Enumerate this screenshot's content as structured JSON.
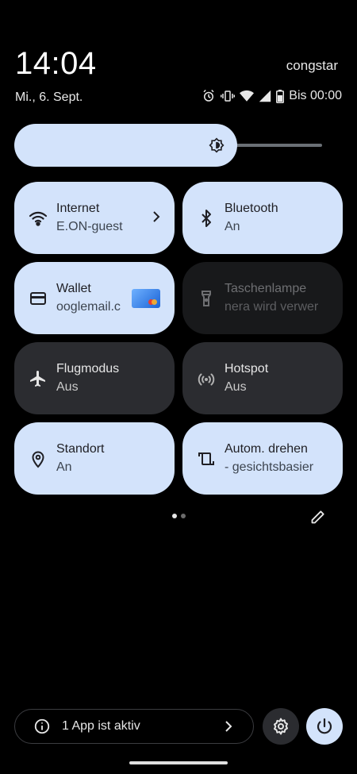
{
  "status": {
    "time": "14:04",
    "carrier": "congstar",
    "date": "Mi., 6. Sept.",
    "battery_text": "Bis 00:00",
    "icons": [
      "alarm-icon",
      "vibrate-icon",
      "wifi-icon",
      "cell-signal-icon",
      "battery-icon"
    ]
  },
  "brightness": {
    "level": 0.72,
    "icon": "brightness-icon"
  },
  "tiles": [
    {
      "title": "Internet",
      "subtitle": "E.ON-guest",
      "icon": "wifi-icon",
      "state": "on",
      "has_chevron": true
    },
    {
      "title": "Bluetooth",
      "subtitle": "An",
      "icon": "bluetooth-icon",
      "state": "on"
    },
    {
      "title": "Wallet",
      "subtitle": "ooglemail.c",
      "icon": "wallet-icon",
      "state": "on",
      "card_icon": "paypal-card-icon"
    },
    {
      "title": "Taschenlampe",
      "subtitle": "nera wird verwer",
      "icon": "flashlight-icon",
      "state": "unavailable"
    },
    {
      "title": "Flugmodus",
      "subtitle": "Aus",
      "icon": "airplane-icon",
      "state": "off"
    },
    {
      "title": "Hotspot",
      "subtitle": "Aus",
      "icon": "hotspot-icon",
      "state": "off"
    },
    {
      "title": "Standort",
      "subtitle": "An",
      "icon": "location-icon",
      "state": "on"
    },
    {
      "title": "Autom. drehen",
      "subtitle": "- gesichtsbasier",
      "icon": "auto-rotate-icon",
      "state": "on"
    }
  ],
  "pager": {
    "pages": 2,
    "current": 1
  },
  "footer": {
    "active_apps_label": "1 App ist aktiv",
    "settings_icon": "gear-icon",
    "power_icon": "power-icon"
  },
  "colors": {
    "tile_on": "#d3e3fb",
    "tile_off": "#2b2c30",
    "background": "#000000"
  }
}
